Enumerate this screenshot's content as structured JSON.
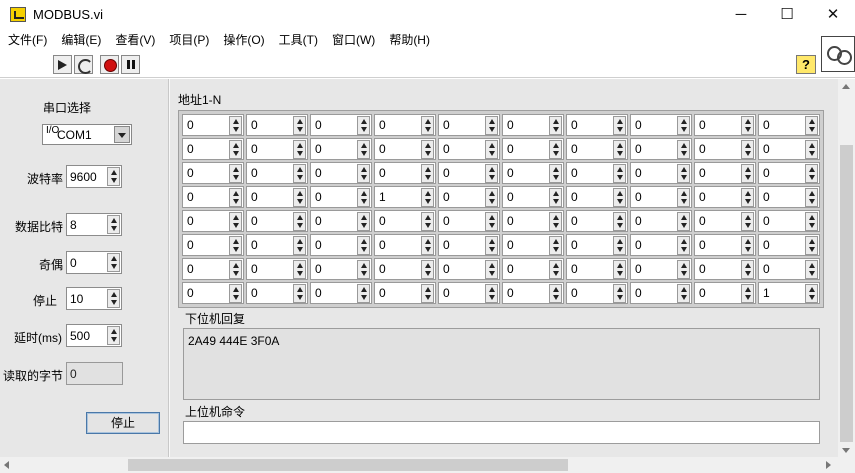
{
  "window": {
    "title": "MODBUS.vi",
    "minimize_glyph": "─",
    "maximize_glyph": "☐",
    "close_glyph": "✕"
  },
  "menu": [
    "文件(F)",
    "编辑(E)",
    "查看(V)",
    "项目(P)",
    "操作(O)",
    "工具(T)",
    "窗口(W)",
    "帮助(H)"
  ],
  "toolbar": {
    "icons": [
      "run-arrow-icon",
      "run-continuously-icon",
      "abort-stop-icon",
      "pause-icon"
    ],
    "help_label": "?"
  },
  "panel": {
    "serial_port": {
      "label": "串口选择",
      "value": "COM1",
      "glyph": "I/O"
    },
    "baud_rate": {
      "label": "波特率",
      "value": "9600"
    },
    "data_bits": {
      "label": "数据比特",
      "value": "8"
    },
    "parity": {
      "label": "奇偶",
      "value": "0"
    },
    "stop_bits": {
      "label": "停止",
      "value": "10"
    },
    "delay": {
      "label": "延时(ms)",
      "value": "500"
    },
    "bytes_read": {
      "label": "读取的字节",
      "value": "0"
    },
    "stop_button": {
      "label": "停止"
    }
  },
  "array": {
    "label": "地址1-N",
    "rows": [
      [
        "0",
        "0",
        "0",
        "0",
        "0",
        "0",
        "0",
        "0",
        "0",
        "0"
      ],
      [
        "0",
        "0",
        "0",
        "0",
        "0",
        "0",
        "0",
        "0",
        "0",
        "0"
      ],
      [
        "0",
        "0",
        "0",
        "0",
        "0",
        "0",
        "0",
        "0",
        "0",
        "0"
      ],
      [
        "0",
        "0",
        "0",
        "1",
        "0",
        "0",
        "0",
        "0",
        "0",
        "0"
      ],
      [
        "0",
        "0",
        "0",
        "0",
        "0",
        "0",
        "0",
        "0",
        "0",
        "0"
      ],
      [
        "0",
        "0",
        "0",
        "0",
        "0",
        "0",
        "0",
        "0",
        "0",
        "0"
      ],
      [
        "0",
        "0",
        "0",
        "0",
        "0",
        "0",
        "0",
        "0",
        "0",
        "0"
      ],
      [
        "0",
        "0",
        "0",
        "0",
        "0",
        "0",
        "0",
        "0",
        "0",
        "1"
      ]
    ]
  },
  "slave_reply": {
    "label": "下位机回复",
    "value": "2A49 444E 3F0A"
  },
  "master_command": {
    "label": "上位机命令",
    "value": ""
  },
  "colors": {
    "panel_bg": "#e7e7e7",
    "abort_red": "#d01010",
    "help_yellow": "#ffe86a"
  }
}
